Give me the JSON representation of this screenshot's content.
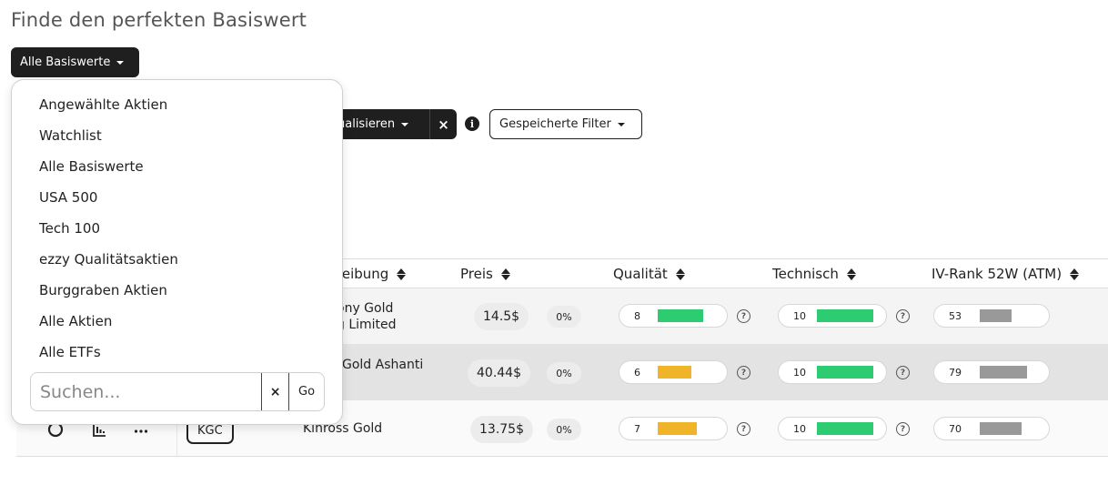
{
  "page": {
    "title": "Finde den perfekten Basiswert"
  },
  "universe_dropdown": {
    "selected": "Alle Basiswerte",
    "options": [
      "Angewählte Aktien",
      "Watchlist",
      "Alle Basiswerte",
      "USA 500",
      "Tech 100",
      "ezzy Qualitätsaktien",
      "Burggraben Aktien",
      "Alle Aktien",
      "Alle ETFs"
    ],
    "search_placeholder": "Suchen...",
    "clear_symbol": "×",
    "go_label": "Go"
  },
  "filter_bar": {
    "visualize_label": "ualisieren",
    "clear_symbol": "×",
    "info_symbol": "i",
    "saved_filters_label": "Gespeicherte Filter"
  },
  "table": {
    "headers": {
      "description": "reibung",
      "price": "Preis",
      "quality": "Qualität",
      "technical": "Technisch",
      "ivrank": "IV-Rank 52W (ATM)"
    },
    "rows": [
      {
        "ticker": "",
        "description": [
          "ony Gold",
          "g Limited"
        ],
        "price": "14.5$",
        "change": "0%",
        "quality": 8,
        "technical": 10,
        "ivrank": 53
      },
      {
        "ticker": "",
        "description": [
          "Gold Ashanti",
          ""
        ],
        "price": "40.44$",
        "change": "0%",
        "quality": 6,
        "technical": 10,
        "ivrank": 79
      },
      {
        "ticker": "KGC",
        "description": [
          "Kinross Gold",
          ""
        ],
        "price": "13.75$",
        "change": "0%",
        "quality": 7,
        "technical": 10,
        "ivrank": 70
      }
    ],
    "help_symbol": "?",
    "bar_colors": {
      "high": "#2ecc71",
      "mid": "#f0b429",
      "neutral": "#999999"
    }
  },
  "row_actions": {
    "icons": [
      "circle-icon",
      "chart-icon",
      "more-icon"
    ]
  }
}
